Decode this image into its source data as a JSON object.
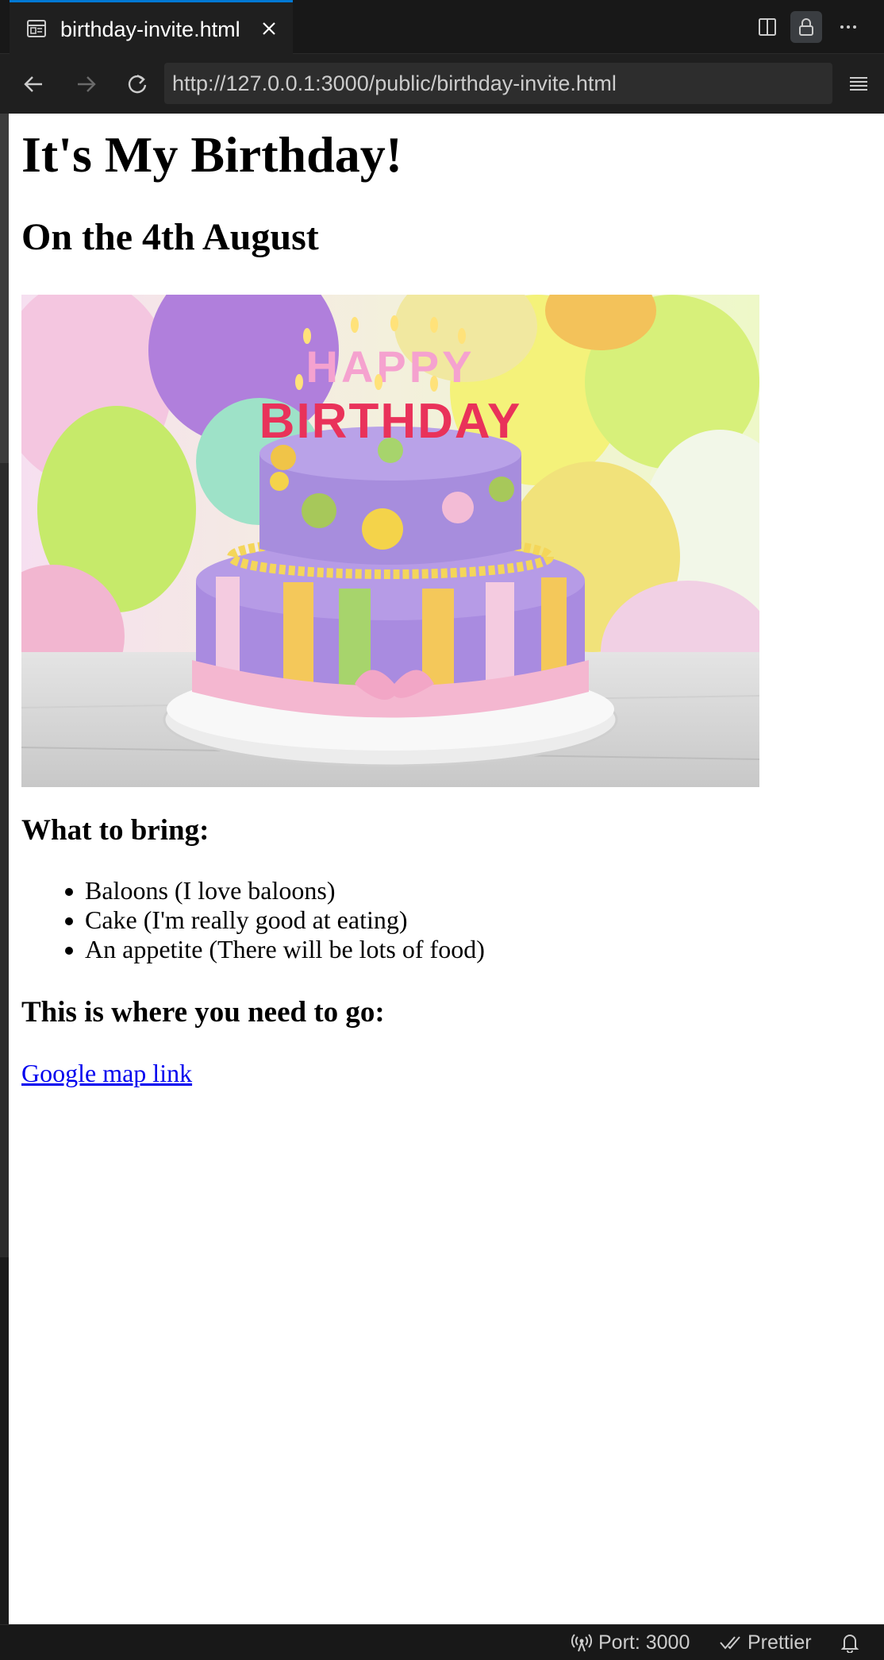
{
  "tab": {
    "title": "birthday-invite.html",
    "icon": "preview-icon"
  },
  "address_bar": {
    "url": "http://127.0.0.1:3000/public/birthday-invite.html"
  },
  "page": {
    "heading": "It's My Birthday!",
    "subheading": "On the 4th August",
    "image": {
      "description_icon": "birthday-cake-image",
      "cake_text_top": "HAPPY",
      "cake_text_bottom": "BIRTHDAY"
    },
    "bring_heading": "What to bring:",
    "bring_items": [
      "Baloons (I love baloons)",
      "Cake (I'm really good at eating)",
      "An appetite (There will be lots of food)"
    ],
    "location_heading": "This is where you need to go:",
    "map_link": "Google map link"
  },
  "status_bar": {
    "port": "Port: 3000",
    "prettier": "Prettier"
  },
  "colors": {
    "accent": "#0078d4",
    "link": "#0000ee",
    "chrome_bg": "#1f1f1f"
  }
}
